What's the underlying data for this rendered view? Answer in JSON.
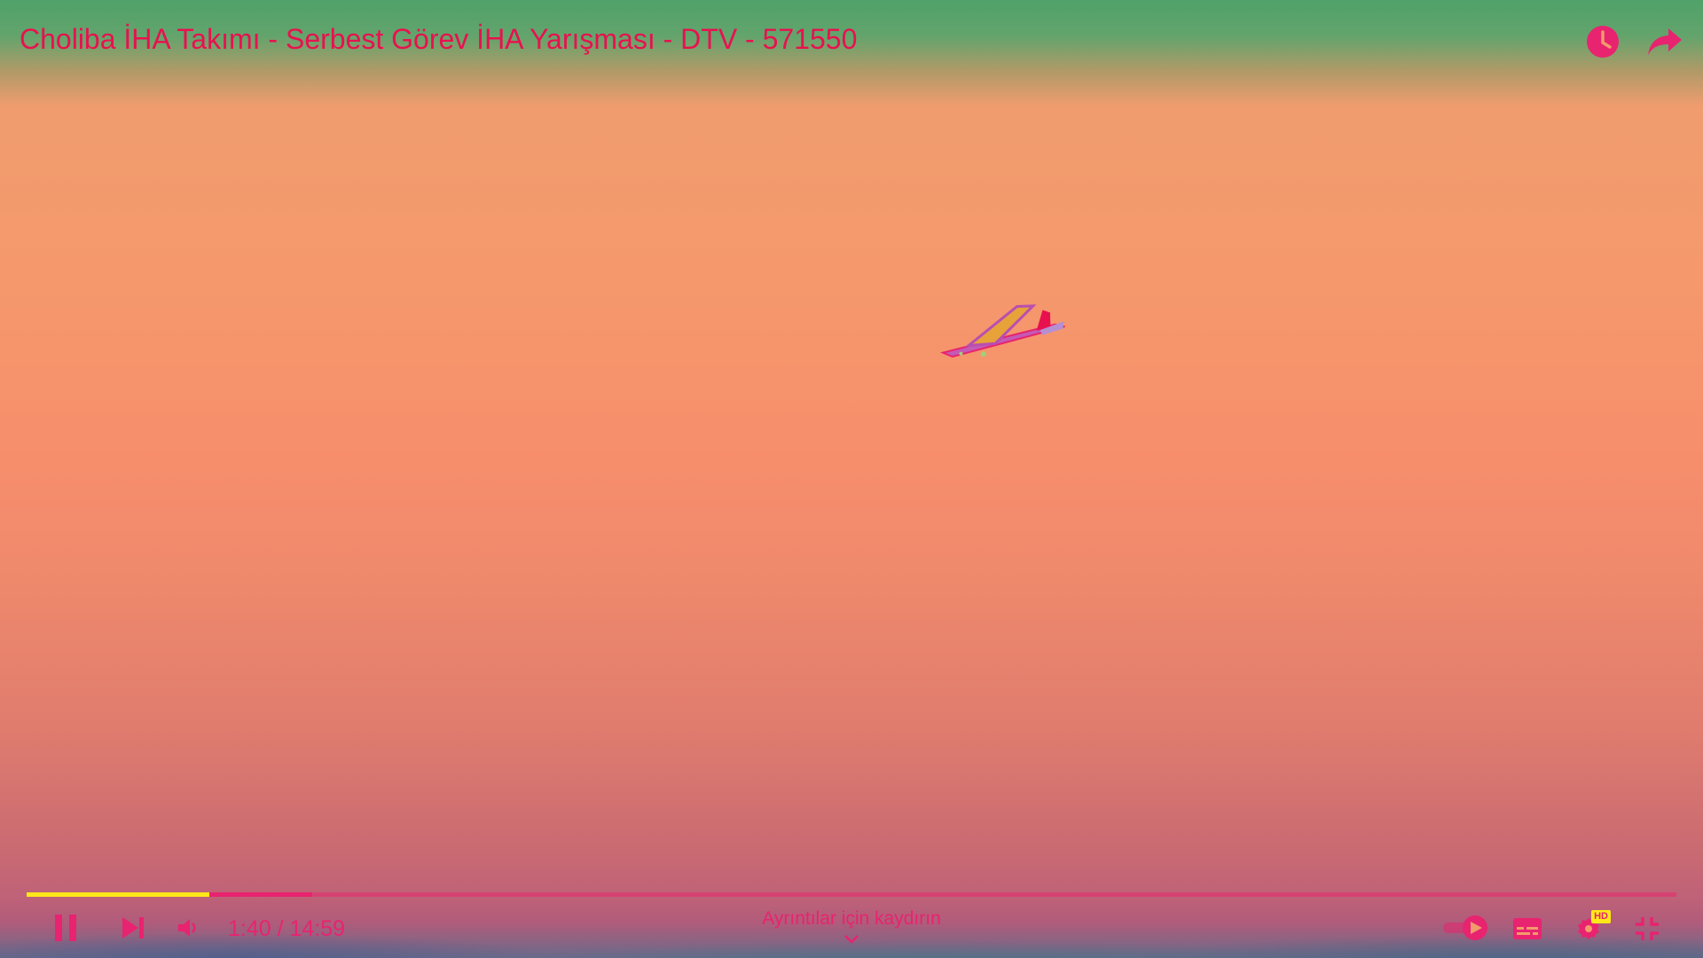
{
  "video": {
    "title": "Choliba İHA Takımı - Serbest Görev İHA Yarışması - DTV - 571550"
  },
  "top_actions": {
    "watch_later_icon": "clock-icon",
    "share_icon": "share-arrow-icon"
  },
  "player": {
    "current_time": "1:40",
    "duration": "14:59",
    "time_display": "1:40 / 14:59",
    "played_fraction": 0.111,
    "buffered_fraction": 0.173,
    "swipe_hint": "Ayrıntılar için kaydırın",
    "quality_badge": "HD"
  },
  "colors": {
    "accent": "#e8236f",
    "played": "#ffe81a",
    "title": "#e8114f"
  }
}
